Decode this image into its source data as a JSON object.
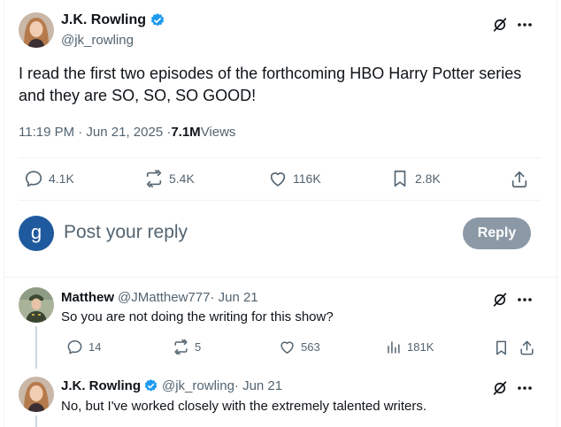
{
  "main_post": {
    "author_name": "J.K. Rowling",
    "author_handle": "@jk_rowling",
    "text": "I read the first two episodes of the forthcoming HBO Harry Potter series and they are SO, SO, SO GOOD!",
    "timestamp": "11:19 PM · Jun 21, 2025 · ",
    "views_count": "7.1M",
    "views_label": " Views",
    "stats": {
      "replies": "4.1K",
      "reposts": "5.4K",
      "likes": "116K",
      "bookmarks": "2.8K"
    }
  },
  "composer": {
    "avatar_letter": "g",
    "placeholder": "Post your reply",
    "button_label": "Reply"
  },
  "replies": [
    {
      "author_name": "Matthew",
      "author_handle": "@JMatthew777",
      "date": " · Jun 21",
      "text": "So you are not doing the writing for this show?",
      "stats": {
        "replies": "14",
        "reposts": "5",
        "likes": "563",
        "views": "181K"
      }
    },
    {
      "author_name": "J.K. Rowling",
      "author_handle": "@jk_rowling",
      "date": " · Jun 21",
      "text": "No, but I've worked closely with the extremely talented writers."
    }
  ],
  "colors": {
    "verified": "#1d9bf0",
    "muted": "#536471",
    "composer_avatar": "#1f5a9e",
    "reply_button": "#8b98a5"
  },
  "icons": [
    "grok-icon",
    "more-icon",
    "verified-badge-icon",
    "reply-icon",
    "repost-icon",
    "like-icon",
    "bookmark-icon",
    "share-icon",
    "views-icon"
  ]
}
